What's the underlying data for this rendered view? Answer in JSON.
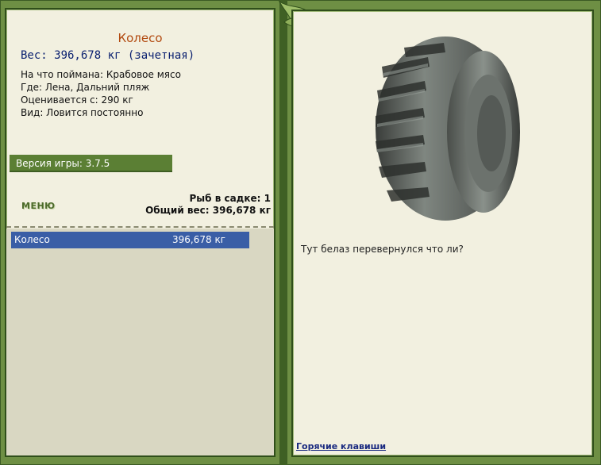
{
  "fish": {
    "name": "Колесо",
    "weight_line": "Вес: 396,678 кг (зачетная)",
    "bait_line": "На что поймана: Крабовое мясо",
    "location_line": "Где: Лена, Дальний пляж",
    "valued_line": "Оценивается с: 290 кг",
    "type_line": "Вид: Ловится постоянно"
  },
  "version_label": "Версия игры: 3.7.5",
  "menu_label": "МЕНЮ",
  "cage": {
    "count_line": "Рыб в садке: 1",
    "total_line": "Общий вес: 396,678 кг"
  },
  "catch_list": [
    {
      "name": "Колесо",
      "weight": "396,678 кг"
    }
  ],
  "description": "Тут белаз перевернулся что ли?",
  "hotkeys_label": "Горячие клавиши",
  "colors": {
    "frame_green": "#6e8f44",
    "panel_bg": "#f2f0e0",
    "title_orange": "#b24a10",
    "weight_blue": "#0a2070",
    "selection_blue": "#3a5ea6"
  }
}
